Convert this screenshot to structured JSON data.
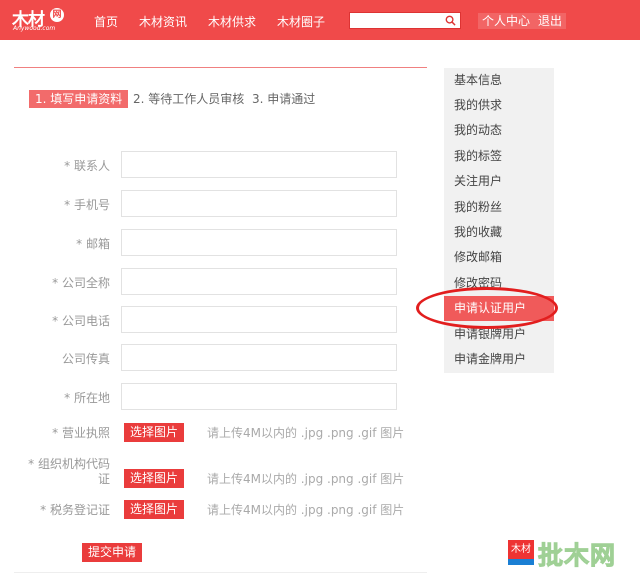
{
  "header": {
    "logo_text": "木材",
    "logo_badge": "网",
    "logo_sub": "Anywood.com",
    "nav": [
      {
        "label": "首页"
      },
      {
        "label": "木材资讯"
      },
      {
        "label": "木材供求"
      },
      {
        "label": "木材圈子"
      }
    ],
    "search": {
      "placeholder": "",
      "value": ""
    },
    "user_center": "个人中心",
    "logout": "退出"
  },
  "steps": [
    {
      "label": "1. 填写申请资料",
      "active": true
    },
    {
      "label": "2. 等待工作人员审核",
      "active": false
    },
    {
      "label": "3. 申请通过",
      "active": false
    }
  ],
  "form": {
    "fields": [
      {
        "label": "* 联系人",
        "value": ""
      },
      {
        "label": "* 手机号",
        "value": ""
      },
      {
        "label": "* 邮箱",
        "value": ""
      },
      {
        "label": "* 公司全称",
        "value": ""
      },
      {
        "label": "* 公司电话",
        "value": ""
      },
      {
        "label": "公司传真",
        "value": ""
      },
      {
        "label": "* 所在地",
        "value": ""
      }
    ],
    "uploads": [
      {
        "label_line1": "* 营业执照",
        "label_line2": "",
        "button": "选择图片",
        "hint": "请上传4M以内的 .jpg .png .gif 图片"
      },
      {
        "label_line1": "* 组织机构代码",
        "label_line2": "证",
        "button": "选择图片",
        "hint": "请上传4M以内的 .jpg .png .gif 图片"
      },
      {
        "label_line1": "* 税务登记证",
        "label_line2": "",
        "button": "选择图片",
        "hint": "请上传4M以内的 .jpg .png .gif 图片"
      }
    ],
    "submit": "提交申请"
  },
  "sidebar": {
    "items": [
      {
        "label": "基本信息"
      },
      {
        "label": "我的供求"
      },
      {
        "label": "我的动态"
      },
      {
        "label": "我的标签"
      },
      {
        "label": "关注用户"
      },
      {
        "label": "我的粉丝"
      },
      {
        "label": "我的收藏"
      },
      {
        "label": "修改邮箱"
      },
      {
        "label": "修改密码"
      },
      {
        "label": "申请认证用户",
        "active": true
      },
      {
        "label": "申请银牌用户"
      },
      {
        "label": "申请金牌用户"
      }
    ]
  },
  "watermark": {
    "badge": "木材",
    "text": "批木网"
  },
  "colors": {
    "brand_red": "#f04a4a",
    "button_red": "#ea3c3c",
    "active_step": "#f26b6b",
    "sidebar_bg": "#f1f1f1",
    "highlight_ring": "#e21e1e"
  }
}
